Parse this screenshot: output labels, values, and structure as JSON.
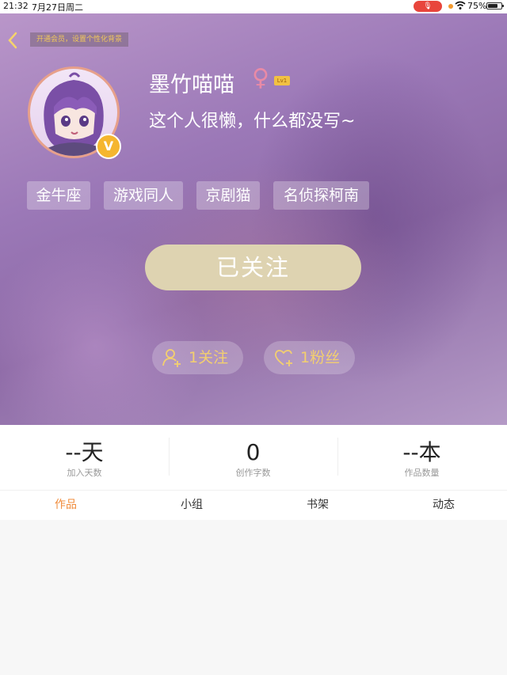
{
  "status_bar": {
    "time": "21:32",
    "date": "7月27日周二",
    "battery": "75%",
    "battery_level": 0.75,
    "icons": [
      "microphone-icon",
      "wifi-icon",
      "battery-icon"
    ]
  },
  "header": {
    "vip_banner": "开通会员，设置个性化背景",
    "username": "墨竹喵喵",
    "gender_symbol": "♀",
    "level": "Lv1",
    "vip_badge": "V",
    "bio": "这个人很懒，什么都没写~",
    "tags": [
      "金牛座",
      "游戏同人",
      "京剧猫",
      "名侦探柯南"
    ],
    "follow_button": "已关注",
    "following": "1关注",
    "followers": "1粉丝"
  },
  "stats": [
    {
      "value": "--天",
      "label": "加入天数"
    },
    {
      "value": "0",
      "label": "创作字数"
    },
    {
      "value": "--本",
      "label": "作品数量"
    }
  ],
  "tabs": [
    "作品",
    "小组",
    "书架",
    "动态"
  ],
  "colors": {
    "accent": "#f08c3c",
    "gold": "#f3cf6f",
    "follow_button": "#ded3b1",
    "header_purple": "#9b78b7"
  }
}
